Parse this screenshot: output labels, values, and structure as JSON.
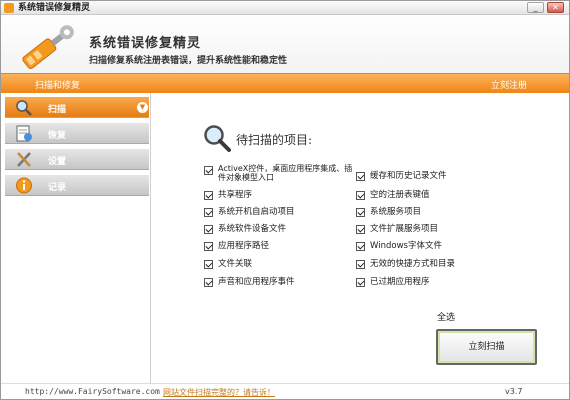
{
  "window": {
    "title": "系统错误修复精灵"
  },
  "header": {
    "app_title": "系统错误修复精灵",
    "subtitle": "扫描修复系统注册表错误，提升系统性能和稳定性"
  },
  "orange_bar": {
    "left_text": "扫描和修复",
    "right_text": "立刻注册"
  },
  "sidebar": {
    "items": [
      {
        "label": "扫描",
        "icon": "magnifier-icon",
        "active": true
      },
      {
        "label": "恢复",
        "icon": "restore-icon",
        "active": false
      },
      {
        "label": "设置",
        "icon": "tools-icon",
        "active": false
      },
      {
        "label": "记录",
        "icon": "info-icon",
        "active": false
      }
    ]
  },
  "main": {
    "heading": "待扫描的项目:",
    "left_options": [
      {
        "label": "ActiveX控件，桌面应用程序集成、插件对象模型入口",
        "checked": true
      },
      {
        "label": "共享程序",
        "checked": true
      },
      {
        "label": "系统开机自启动项目",
        "checked": true
      },
      {
        "label": "系统软件设备文件",
        "checked": true
      },
      {
        "label": "应用程序路径",
        "checked": true
      },
      {
        "label": "文件关联",
        "checked": true
      },
      {
        "label": "声音和应用程序事件",
        "checked": true
      }
    ],
    "right_options": [
      {
        "label": "缓存和历史记录文件",
        "checked": true
      },
      {
        "label": "空的注册表键值",
        "checked": true
      },
      {
        "label": "系统服务项目",
        "checked": true
      },
      {
        "label": "文件扩展服务项目",
        "checked": true
      },
      {
        "label": "Windows字体文件",
        "checked": true
      },
      {
        "label": "无效的快捷方式和目录",
        "checked": true
      },
      {
        "label": "已过期应用程序",
        "checked": true
      }
    ],
    "select_all": "全选",
    "scan_button": "立刻扫描"
  },
  "footer": {
    "url": "http://www.FairySoftware.com",
    "link": "网站文件扫描完整的？请告诉！",
    "version": "v3.7"
  },
  "colors": {
    "accent": "#ef8514",
    "sidebar_inactive": "#c6c6c6"
  }
}
